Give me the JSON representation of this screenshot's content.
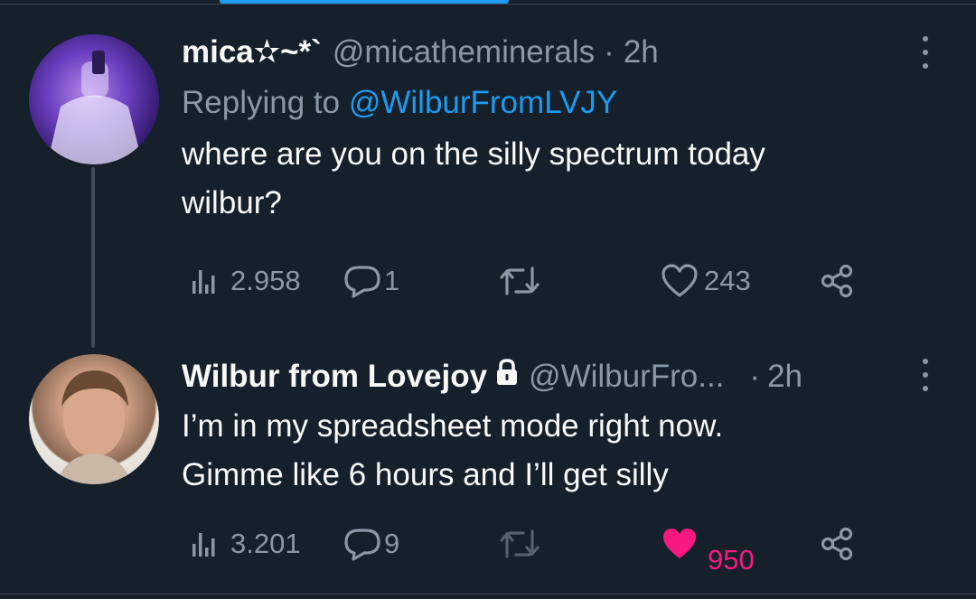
{
  "tweets": [
    {
      "display_name": "mica✫~*`",
      "handle": "@micatheminerals",
      "separator": "·",
      "time": "2h",
      "replying_prefix": "Replying to",
      "replying_to": "@WilburFromLVJY",
      "text_line1": "where are you on the silly spectrum today",
      "text_line2": "wilbur?",
      "views": "2.958",
      "replies": "1",
      "likes": "243",
      "liked": false
    },
    {
      "display_name": "Wilbur from Lovejoy",
      "handle": "@WilburFro...",
      "separator": "·",
      "time": "2h",
      "text_line1": "I’m in my spreadsheet mode right now.",
      "text_line2": "Gimme like 6 hours and I’ll get silly",
      "views": "3.201",
      "replies": "9",
      "likes": "950",
      "liked": true,
      "protected": true
    }
  ],
  "colors": {
    "background": "#15202b",
    "accent": "#1d9bf0",
    "muted": "#8b98a5",
    "like": "#f91880"
  }
}
